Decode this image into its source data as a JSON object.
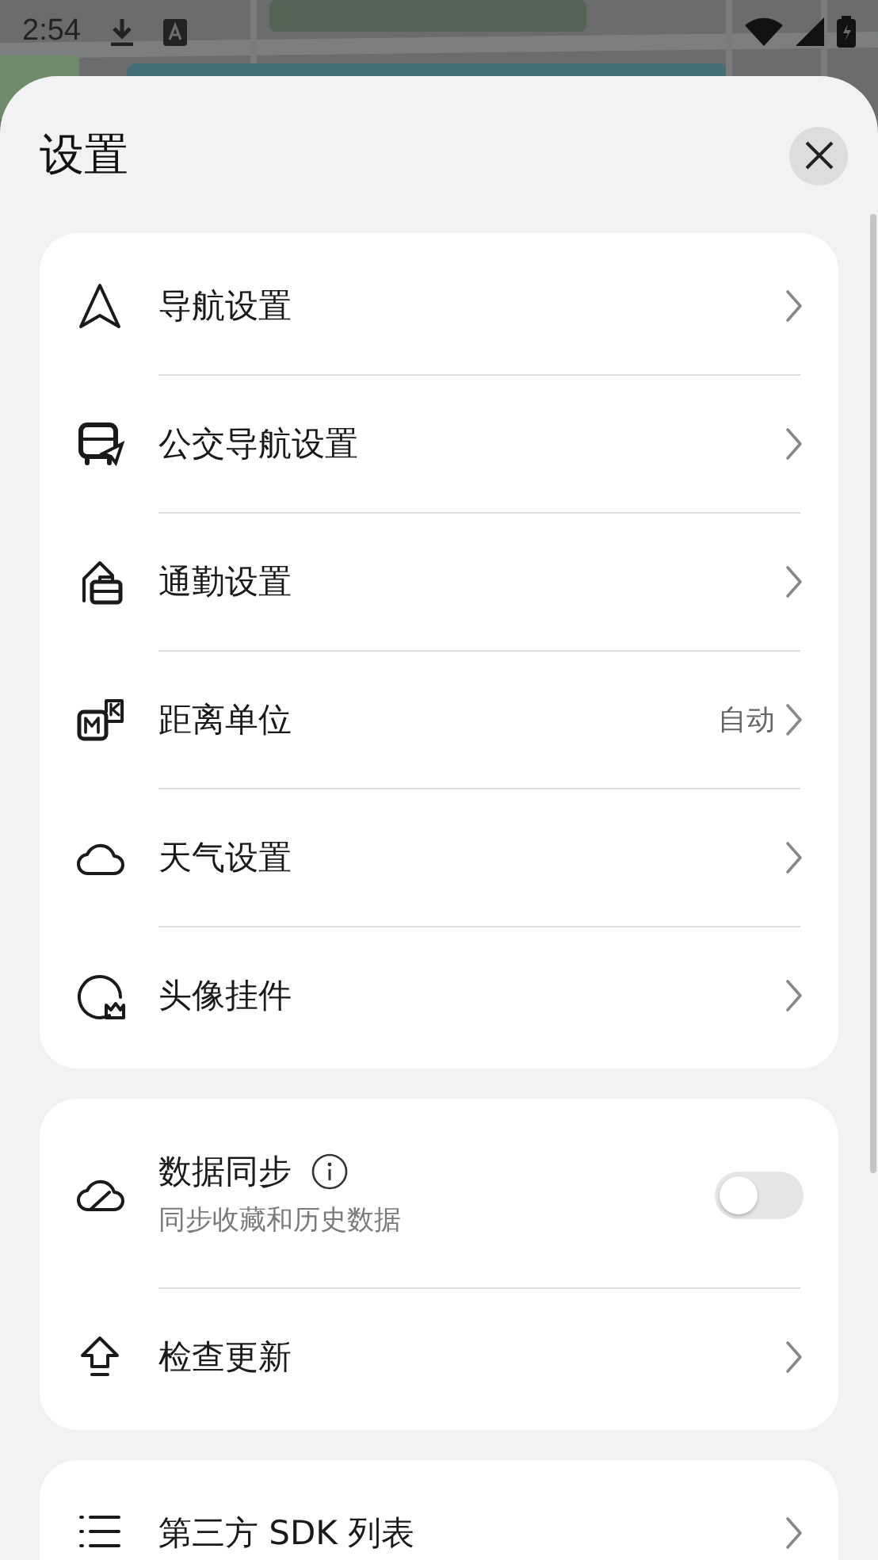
{
  "status_bar": {
    "time": "2:54"
  },
  "title": "设置",
  "sections": [
    {
      "items": [
        {
          "kind": "link",
          "label": "导航设置"
        },
        {
          "kind": "link",
          "label": "公交导航设置"
        },
        {
          "kind": "link",
          "label": "通勤设置"
        },
        {
          "kind": "link",
          "label": "距离单位",
          "value": "自动"
        },
        {
          "kind": "link",
          "label": "天气设置"
        },
        {
          "kind": "link",
          "label": "头像挂件"
        }
      ]
    },
    {
      "items": [
        {
          "kind": "toggle",
          "label": "数据同步",
          "subtitle": "同步收藏和历史数据",
          "on": false
        },
        {
          "kind": "link",
          "label": "检查更新"
        }
      ]
    },
    {
      "items": [
        {
          "kind": "link",
          "label": "第三方 SDK 列表"
        }
      ]
    }
  ]
}
